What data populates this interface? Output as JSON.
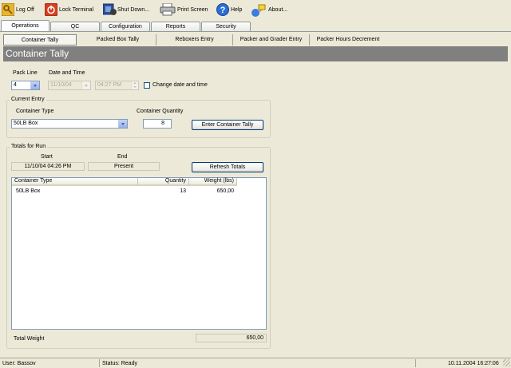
{
  "toolbar": {
    "logoff": "Log Off",
    "lock": "Lock Terminal",
    "shutdown": "Shut Down...",
    "print": "Print Screen",
    "help": "Help",
    "about": "About..."
  },
  "main_tabs": [
    "Operations",
    "QC",
    "Configuration",
    "Reports",
    "Security"
  ],
  "sub_tabs": [
    "Container Tally",
    "Packed Box Tally",
    "Reboxers Entry",
    "Packer and Grader Entry",
    "Packer Hours Decrement"
  ],
  "page_title": "Container Tally",
  "pack_line": {
    "label": "Pack Line",
    "value": "4"
  },
  "date_time": {
    "label": "Date and Time",
    "date": "11/10/04",
    "time": "04:27 PM",
    "change_label": "Change date and time"
  },
  "current_entry": {
    "title": "Current Entry",
    "type_label": "Container Type",
    "type_value": "50LB Box",
    "qty_label": "Container Quantity",
    "qty_value": "8",
    "enter_button": "Enter Container Tally"
  },
  "totals": {
    "title": "Totals for Run",
    "start_label": "Start",
    "end_label": "End",
    "start_value": "11/10/04 04:26 PM",
    "end_value": "Present",
    "refresh_button": "Refresh Totals",
    "columns": [
      "Container Type",
      "Quantity",
      "Weight (lbs)"
    ],
    "rows": [
      {
        "type": "50LB Box",
        "quantity": "13",
        "weight": "650,00"
      }
    ],
    "total_weight_label": "Total Weight",
    "total_weight_value": "650,00"
  },
  "status": {
    "user": "User: Bassov",
    "status": "Status: Ready",
    "datetime": "10.11.2004  16:27:06"
  }
}
